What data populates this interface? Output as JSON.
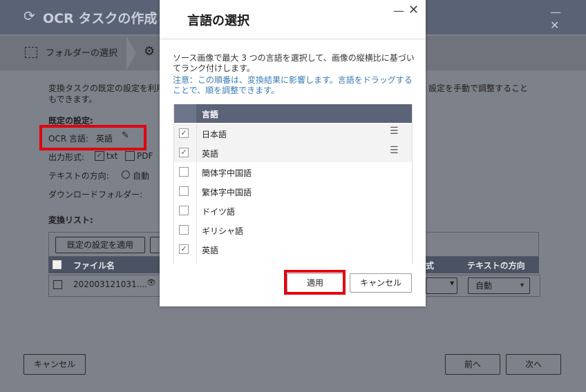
{
  "wizard": {
    "title": "OCR タスクの作成",
    "steps": {
      "step1": "フォルダーの選択"
    },
    "intro": "変換タスクの既定の設定を利用",
    "intro_right": "設定を手動で調整すること",
    "intro2": "もできます。",
    "defaults_heading": "既定の設定:",
    "ocr_lang_label": "OCR 言語:",
    "ocr_lang_value": "英語",
    "output_format_label": "出力形式:",
    "format_txt": "txt",
    "format_pdf": "PDF",
    "text_direction_label": "テキストの方向:",
    "text_direction_value": "自動",
    "download_folder_label": "ダウンロードフォルダー:",
    "convert_list_heading": "変換リスト:",
    "apply_defaults_button": "既定の設定を適用",
    "table": {
      "col_filename": "ファイル名",
      "col_format_partial": "式",
      "col_direction": "テキストの方向",
      "row_filename": "202003121031....",
      "row_direction": "自動"
    },
    "cancel_button": "キャンセル",
    "prev_button": "前へ",
    "next_button": "次へ"
  },
  "modal": {
    "title": "言語の選択",
    "description": "ソース画像で最大 3 つの言語を選択して、画像の縦横比に基づいてランク付けします。",
    "note": "注意：この順番は、変換結果に影響します。言語をドラッグすることで、順を調整できます。",
    "table_header": "言語",
    "languages": [
      {
        "label": "日本語",
        "checked": true,
        "draggable": true
      },
      {
        "label": "英語",
        "checked": true,
        "draggable": true
      },
      {
        "label": "簡体字中国語",
        "checked": false
      },
      {
        "label": "繁体字中国語",
        "checked": false
      },
      {
        "label": "ドイツ語",
        "checked": false
      },
      {
        "label": "ギリシャ語",
        "checked": false
      },
      {
        "label": "英語",
        "checked": true
      }
    ],
    "apply_button": "適用",
    "cancel_button": "キャンセル"
  },
  "colors": {
    "highlight": "#e3000f",
    "note": "#3a7bb8",
    "header": "#5b6378"
  }
}
